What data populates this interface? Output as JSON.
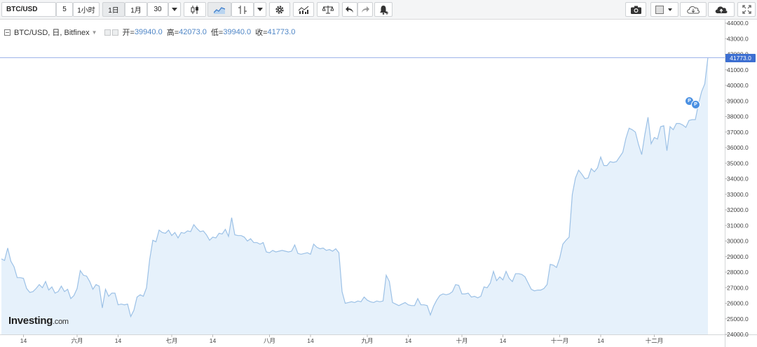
{
  "toolbar": {
    "symbol": "BTC/USD",
    "intervals": [
      "5",
      "1小时",
      "1日",
      "1月",
      "30"
    ],
    "active_interval": "1日"
  },
  "legend": {
    "title": "BTC/USD, 日, Bitfinex",
    "open_label": "开=",
    "open": "39940.0",
    "high_label": "高=",
    "high": "42073.0",
    "low_label": "低=",
    "low": "39940.0",
    "close_label": "收=",
    "close": "41773.0"
  },
  "price_tag": "41773.0",
  "logo": {
    "brand": "Investing",
    "domain": ".com"
  },
  "events": [
    "P",
    "P"
  ],
  "colors": {
    "line": "#9cc1e6",
    "fill": "#e6f1fb",
    "price_tag": "#3d6fd1",
    "event": "#4a90e2"
  },
  "icons": [
    "dropdown-caret-icon",
    "candlestick-icon",
    "area-chart-icon",
    "indicator-icon",
    "settings-gear-icon",
    "study-template-icon",
    "compare-balance-icon",
    "undo-icon",
    "redo-icon",
    "alert-icon",
    "camera-icon",
    "box-icon",
    "cloud-download-icon",
    "cloud-upload-icon",
    "fullscreen-icon"
  ],
  "chart_data": {
    "type": "area",
    "ylim": [
      24000,
      44000
    ],
    "y_ticks": [
      "24000.0",
      "25000.0",
      "26000.0",
      "27000.0",
      "28000.0",
      "29000.0",
      "30000.0",
      "31000.0",
      "32000.0",
      "33000.0",
      "34000.0",
      "35000.0",
      "36000.0",
      "37000.0",
      "38000.0",
      "39000.0",
      "40000.0",
      "41000.0",
      "42000.0",
      "43000.0",
      "44000.0"
    ],
    "x_ticks": [
      {
        "label": "14",
        "i": 7
      },
      {
        "label": "六月",
        "i": 24
      },
      {
        "label": "14",
        "i": 37
      },
      {
        "label": "七月",
        "i": 54
      },
      {
        "label": "14",
        "i": 67
      },
      {
        "label": "八月",
        "i": 85
      },
      {
        "label": "14",
        "i": 98
      },
      {
        "label": "九月",
        "i": 116
      },
      {
        "label": "14",
        "i": 129
      },
      {
        "label": "十月",
        "i": 146
      },
      {
        "label": "14",
        "i": 159
      },
      {
        "label": "十一月",
        "i": 177
      },
      {
        "label": "14",
        "i": 190
      },
      {
        "label": "十二月",
        "i": 207
      }
    ],
    "last_value": 41773,
    "values": [
      28850,
      28750,
      29550,
      28700,
      28350,
      27650,
      27650,
      27600,
      26950,
      26700,
      26750,
      26950,
      27200,
      27000,
      27400,
      26850,
      27050,
      26650,
      26750,
      27100,
      26750,
      26900,
      26300,
      26500,
      26950,
      28100,
      27800,
      27750,
      27400,
      26900,
      27200,
      27100,
      25700,
      26900,
      26450,
      26650,
      26650,
      25900,
      25950,
      25900,
      25950,
      25150,
      25550,
      26400,
      26550,
      26450,
      27000,
      28800,
      30050,
      29950,
      30700,
      30550,
      30500,
      30700,
      30350,
      30550,
      30200,
      30550,
      30500,
      30650,
      30600,
      31050,
      30800,
      30600,
      30650,
      30400,
      30050,
      30250,
      30200,
      30500,
      30450,
      30750,
      30300,
      31500,
      30400,
      30350,
      30350,
      30250,
      30000,
      30150,
      29900,
      29900,
      29800,
      29900,
      29300,
      29250,
      29400,
      29300,
      29350,
      29400,
      29350,
      29300,
      29350,
      29750,
      29200,
      29150,
      29200,
      29250,
      29150,
      29800,
      29600,
      29500,
      29550,
      29400,
      29450,
      29350,
      29500,
      29250,
      26750,
      26000,
      26050,
      26100,
      26050,
      26150,
      26100,
      26400,
      26200,
      26100,
      26050,
      26150,
      26100,
      26150,
      27800,
      27400,
      26050,
      25950,
      25850,
      25950,
      26050,
      25900,
      25850,
      25850,
      26300,
      25900,
      25900,
      25850,
      25250,
      25800,
      26200,
      26500,
      26600,
      26550,
      26600,
      26750,
      27200,
      27150,
      26600,
      26600,
      26650,
      26400,
      26450,
      26350,
      26450,
      27050,
      27000,
      27300,
      28050,
      27450,
      27700,
      27500,
      28050,
      27600,
      27400,
      27900,
      27900,
      27850,
      27700,
      27300,
      26900,
      26800,
      26850,
      26850,
      26950,
      27200,
      28500,
      28450,
      28300,
      28900,
      29800,
      30050,
      30250,
      33000,
      34050,
      34550,
      34300,
      34000,
      34050,
      34650,
      34450,
      34700,
      35400,
      34850,
      34850,
      35100,
      35050,
      35100,
      35400,
      35700,
      36600,
      37250,
      37150,
      37000,
      36200,
      35550,
      36850,
      37950,
      36250,
      36650,
      36550,
      37350,
      37400,
      35800,
      37350,
      37150,
      37550,
      37550,
      37450,
      37300,
      37750,
      37800,
      37800,
      38800,
      39600,
      40100,
      41800
    ]
  }
}
